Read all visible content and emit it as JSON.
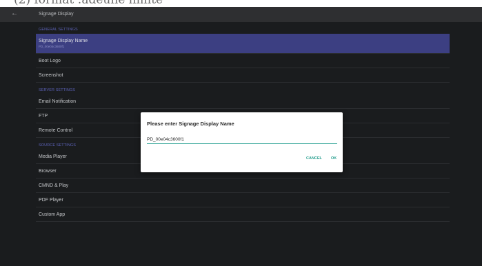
{
  "caption": "(2) format :adeuhe limite",
  "appbar": {
    "back_icon": "arrow-left-icon",
    "title": "Signage Display"
  },
  "list": {
    "general_header": "GENERAL SETTINGS",
    "signage_display_name": {
      "title": "Signage Display Name",
      "subtitle": "PD_00e04c3600f1"
    },
    "boot_logo": "Boot Logo",
    "screenshot": "Screenshot",
    "server_header": "SERVER SETTINGS",
    "email_notification": "Email Notification",
    "ftp": "FTP",
    "remote_control": "Remote Control",
    "source_header": "SOURCE SETTINGS",
    "media_player": "Media Player",
    "browser": "Browser",
    "cmnd_play": "CMND & Play",
    "pdf_player": "PDF Player",
    "custom_app": "Custom App"
  },
  "dialog": {
    "title": "Please enter Signage Display Name",
    "input_value": "PD_00e04c3600f1",
    "cancel_label": "CANCEL",
    "ok_label": "OK"
  },
  "colors": {
    "background": "#1a1c1e",
    "appbar": "#2e2f31",
    "selected_row": "#3c3f82",
    "section_header": "#5c62b8",
    "accent": "#2aa090"
  }
}
